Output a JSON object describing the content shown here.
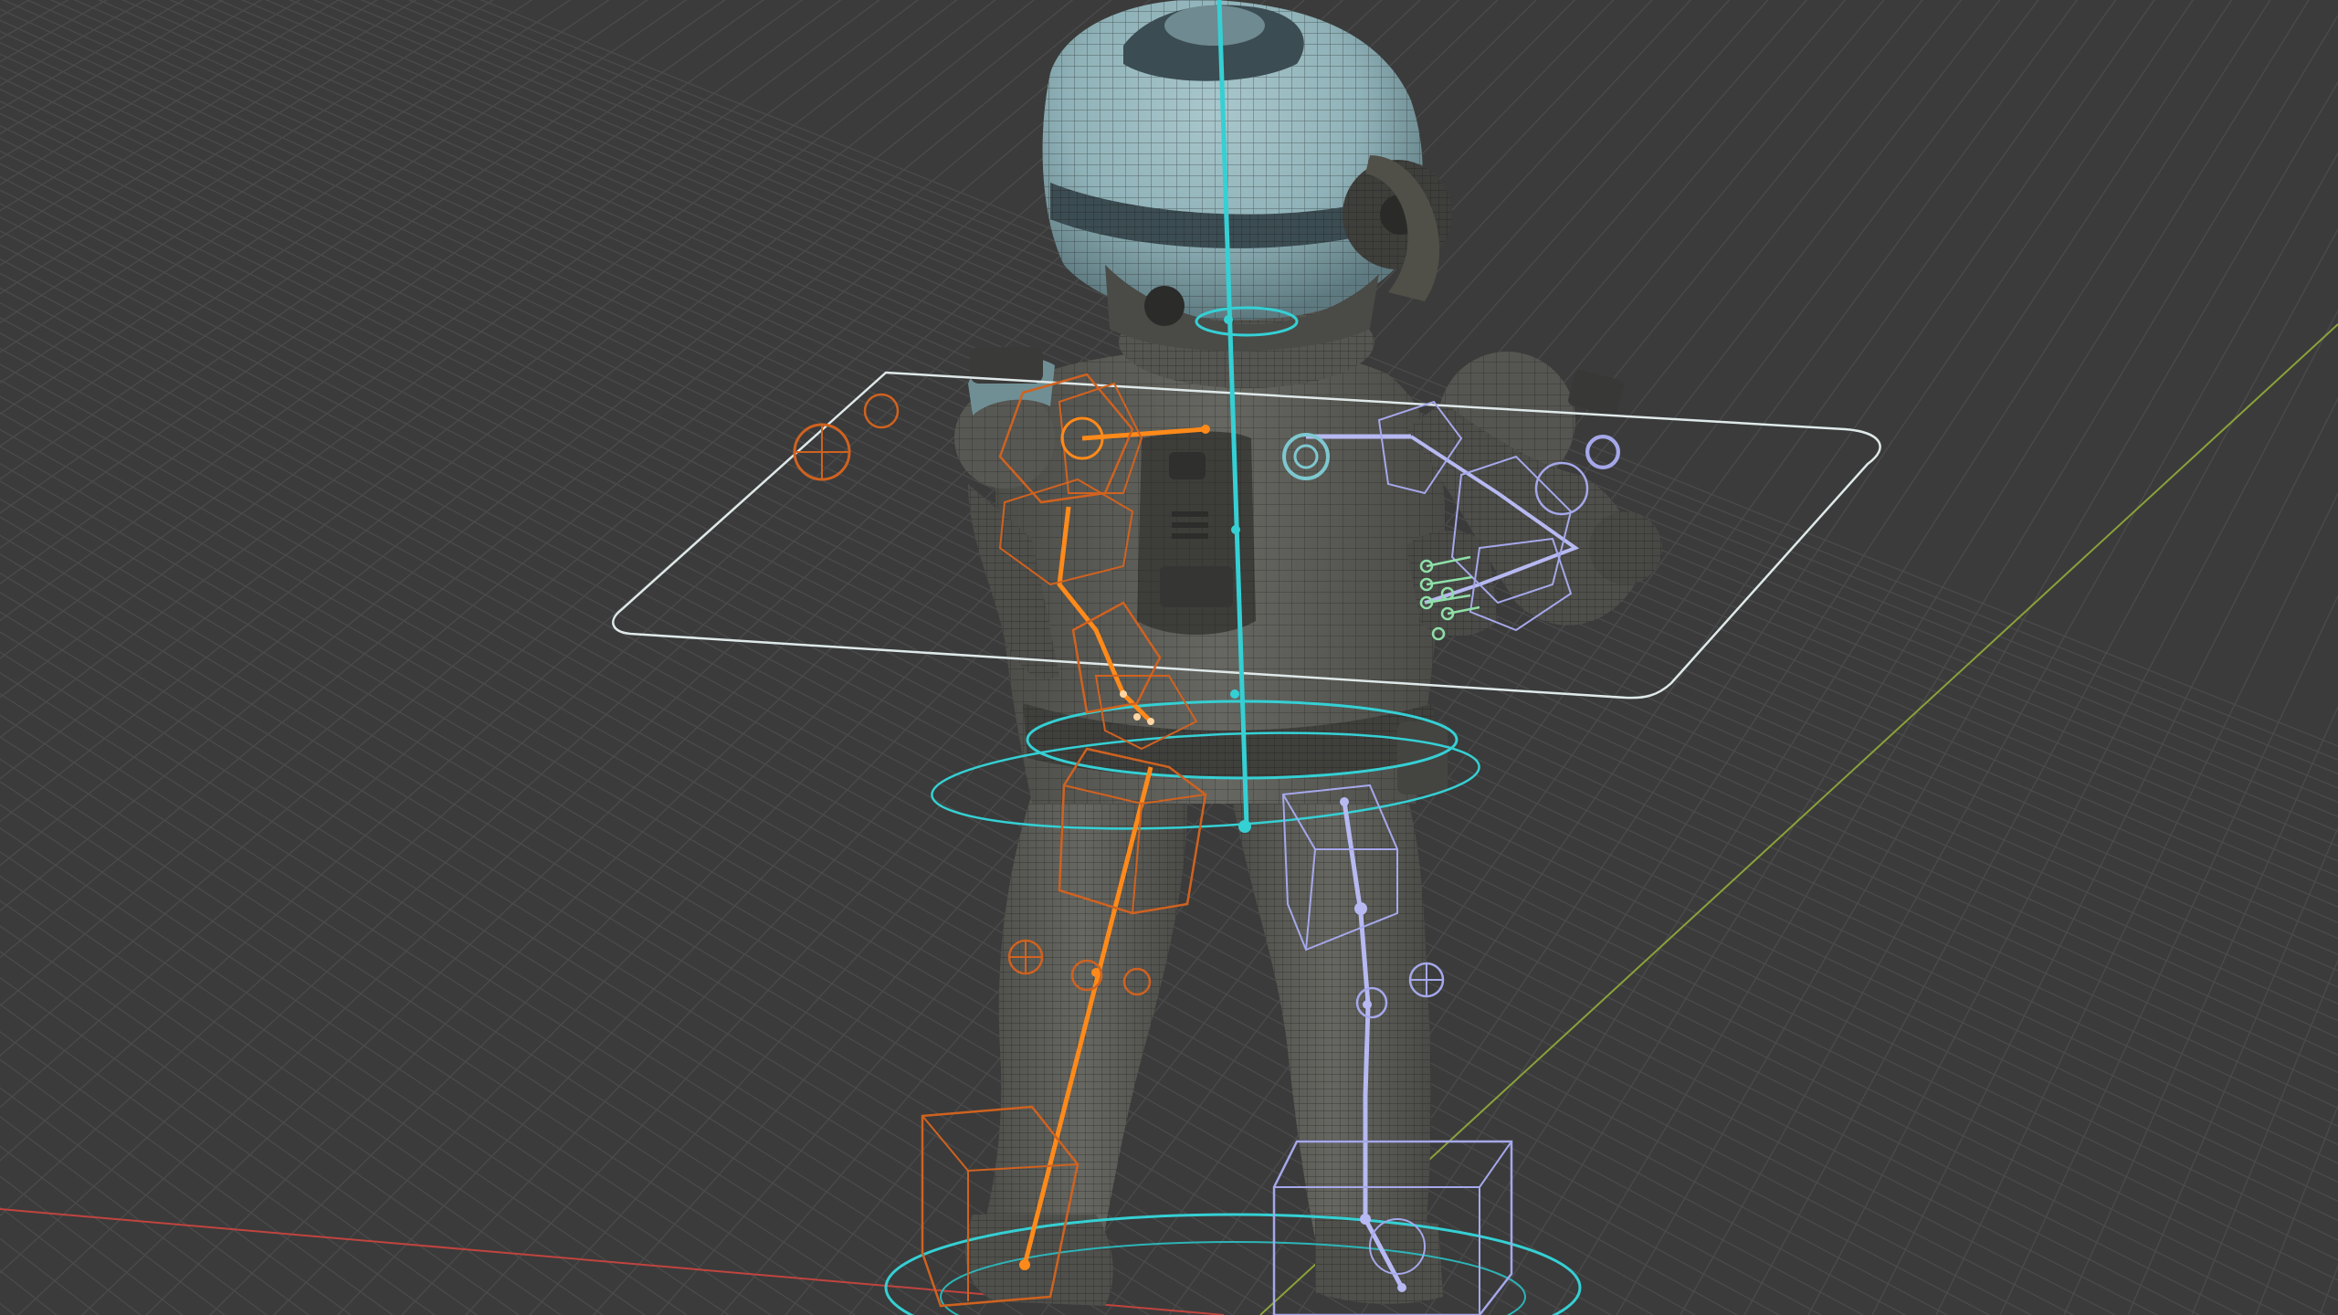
{
  "viewport": {
    "background_color": "#3b3b3b",
    "grid_color": "#4a4a4a",
    "x_axis_color": "#c0443f",
    "y_axis_color": "#8aa23a"
  },
  "model": {
    "subject": "astronaut-character",
    "body_color": "#5c5c57",
    "wire_color": "#1f1f1f",
    "helmet_color": "#8fb2b8",
    "helmet_band_color": "#3b4c52"
  },
  "rig": {
    "controller_color": "#35d0d4",
    "left_chain_color": "#ff8a1a",
    "left_box_color": "#d0621f",
    "right_chain_color": "#b7b9f2"
  }
}
